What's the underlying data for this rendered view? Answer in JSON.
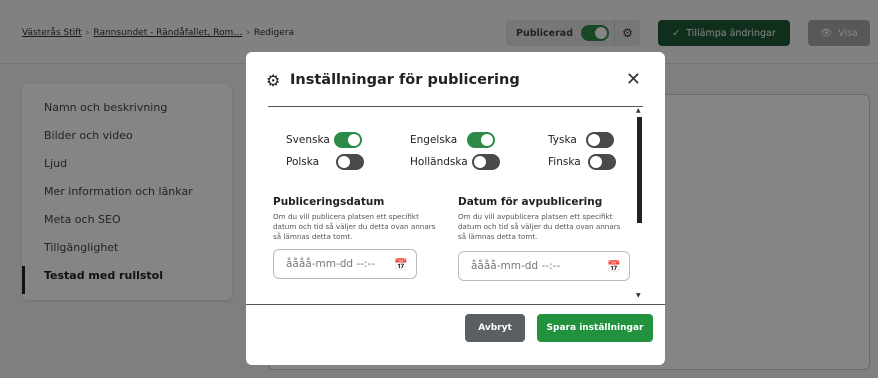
{
  "breadcrumb": {
    "items": [
      "Västerås Stift",
      "Rannsundet - Rändåfallet, Rom…",
      "Redigera"
    ],
    "separator": "›"
  },
  "header": {
    "published_label": "Publicerad",
    "published_on": true,
    "apply_label": "Tillämpa ändringar",
    "show_label": "Visa"
  },
  "sidebar": {
    "items": [
      {
        "label": "Namn och beskrivning"
      },
      {
        "label": "Bilder och video"
      },
      {
        "label": "Ljud"
      },
      {
        "label": "Mer information och länkar"
      },
      {
        "label": "Meta och SEO"
      },
      {
        "label": "Tillgänglighet"
      },
      {
        "label": "Testad med rullstol",
        "active": true
      }
    ]
  },
  "modal": {
    "title": "Inställningar för publicering",
    "languages": [
      {
        "label": "Svenska",
        "on": true
      },
      {
        "label": "Engelska",
        "on": true
      },
      {
        "label": "Tyska",
        "on": false
      },
      {
        "label": "Polska",
        "on": false
      },
      {
        "label": "Holländska",
        "on": false
      },
      {
        "label": "Finska",
        "on": false
      }
    ],
    "publish_date": {
      "title": "Publiceringsdatum",
      "description": "Om du vill publicera platsen ett specifikt datum och tid så väljer du detta ovan annars så lämnas detta tomt.",
      "placeholder": "åååå-mm-dd --:--"
    },
    "unpublish_date": {
      "title": "Datum för avpublicering",
      "description": "Om du vill avpublicera platsen ett specifikt datum och tid så väljer du detta ovan annars så lämnas detta tomt.",
      "placeholder": "åååå-mm-dd --:--"
    },
    "cancel_label": "Avbryt",
    "save_label": "Spara inställningar"
  },
  "colors": {
    "primary_green": "#23923f",
    "dark_green": "#1e5a37",
    "toggle_off": "#4a4a4a"
  }
}
